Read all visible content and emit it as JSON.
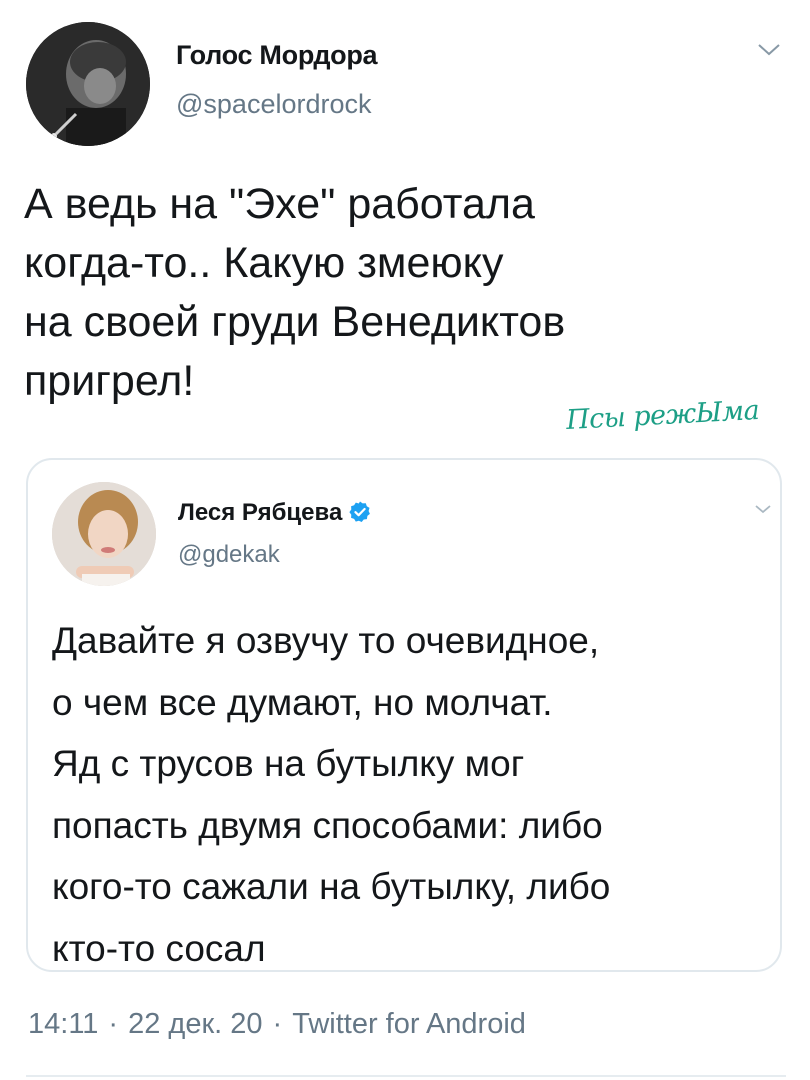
{
  "tweet": {
    "display_name": "Голос Мордора",
    "handle": "@spacelordrock",
    "text": "А ведь на \"Эхе\" работала\nкогда-то.. Какую змеюку\nна своей груди Венедиктов\nпригрел!",
    "time": "14:11",
    "date": "22 дек. 20",
    "source": "Twitter for Android",
    "separator": "·",
    "menu_icon": "chevron-down-icon"
  },
  "watermark": {
    "text": "Псы режЫма",
    "color": "#1d9f86"
  },
  "quoted_tweet": {
    "display_name": "Леся Рябцева",
    "handle": "@gdekak",
    "verified": true,
    "text": "Давайте я озвучу то очевидное,\nо чем все думают, но молчат.\nЯд с трусов на бутылку мог\nпопасть двумя способами: либо\nкого-то сажали на бутылку, либо\nкто-то сосал"
  },
  "colors": {
    "text_primary": "#14171a",
    "text_secondary": "#657786",
    "border": "#e1e8ed",
    "verified_blue": "#1da1f2"
  }
}
